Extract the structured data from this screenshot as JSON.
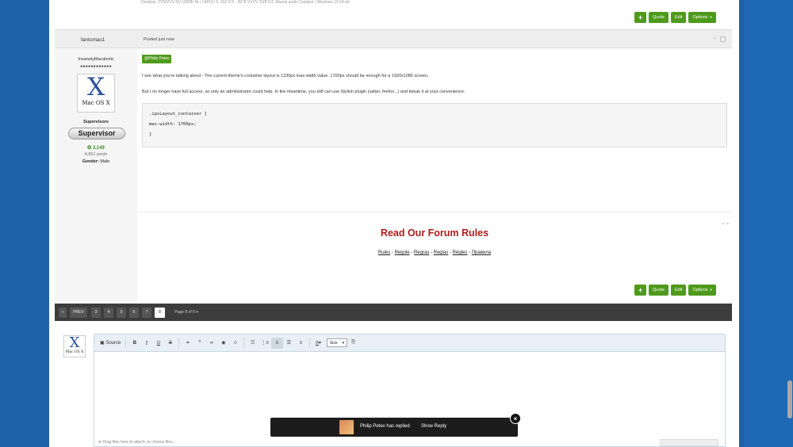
{
  "top_cut_text": "Desktop: ZVWZVV NV (2008) Nr i / APUV 0, 10Z 4 R , B2 B VVVV 2GB G1, Mazza audio Catalyst / Windows 10 64-bit",
  "actions": {
    "plus": "+",
    "quote": "Quote",
    "edit": "Edit",
    "options": "Options"
  },
  "post": {
    "author": "fantomas1",
    "posted": "Posted just now",
    "user": {
      "name": "InsanelyMacaholic",
      "dots": "●●●●●●●●●●●●",
      "avatar_x": "X",
      "avatar_caption": "Mac OS X",
      "group": "Supervisors",
      "rank_badge": "Supervisor",
      "reputation": "3,149",
      "posts": "4,661 posts",
      "gender_label": "Gender:",
      "gender_value": "Male"
    },
    "mention": "@Philip Petev",
    "para1": "I see what you're talking about - The current theme's container layout is 1230px max-width value. 1700px should be enough for a 1920x1080 screen.",
    "para2": "But I no longer have full access, so only an administrator could help. In the meantime, you still can use Stylish plugin (safari, firefox...) and tweak it at your convenience.",
    "code": [
      ".ipsLayout_container {",
      "max-width: 1700px;",
      "}"
    ],
    "signature": {
      "title": "Read Our Forum Rules",
      "links": [
        "Rules",
        "Regole",
        "Regras",
        "Reglas",
        "Règles",
        "Правила"
      ],
      "sep": " - "
    }
  },
  "pagination": {
    "first": "«",
    "prev": "PREV",
    "pages": [
      "3",
      "4",
      "5",
      "6",
      "7",
      "8"
    ],
    "current": "8",
    "summary": "Page 8 of 8"
  },
  "editor": {
    "avatar_x": "X",
    "avatar_caption": "Mac OS X",
    "source_label": "Source",
    "size_label": "Size",
    "attach_text": "Drag files here to attach, or choose files..."
  },
  "toast": {
    "message": "Philip Petev has replied",
    "link": "Show Reply",
    "close": "×"
  },
  "colors": {
    "accent": "#4f9a1d",
    "sig_title": "#b01c1c",
    "page_bg": "#1f5fa6"
  }
}
